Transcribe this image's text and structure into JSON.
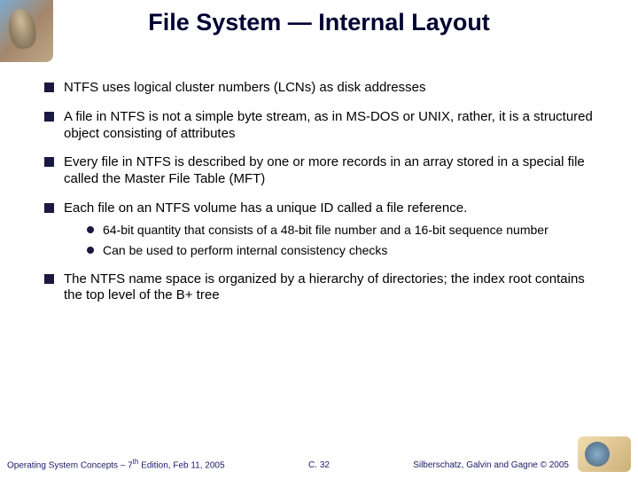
{
  "title": "File System — Internal Layout",
  "bullets": {
    "b1": "NTFS uses logical cluster numbers (LCNs) as disk addresses",
    "b2": "A file in NTFS is not a simple byte stream, as in MS-DOS or UNIX, rather, it is a structured object consisting of attributes",
    "b3": "Every file in NTFS is described by one or more records in an array stored in a special file called the Master File Table (MFT)",
    "b4": "Each file on an NTFS volume has a unique ID called a file reference.",
    "b4_sub1": "64-bit quantity that consists of a 48-bit file number and a 16-bit sequence number",
    "b4_sub2": "Can be used to perform internal consistency checks",
    "b5": "The NTFS name space is organized by a hierarchy of directories; the index root contains the top level of the B+ tree"
  },
  "footer": {
    "left_prefix": "Operating System Concepts – 7",
    "left_sup": "th",
    "left_suffix": " Edition, Feb 11, 2005",
    "center": "C. 32",
    "right": "Silberschatz, Galvin and Gagne © 2005"
  }
}
